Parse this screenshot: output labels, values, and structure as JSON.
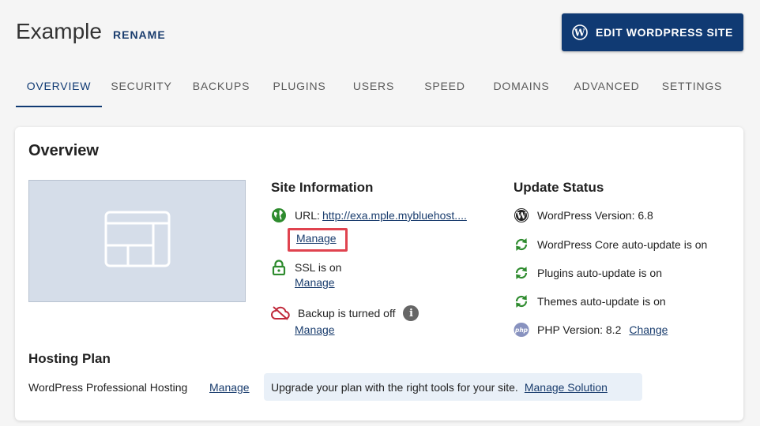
{
  "header": {
    "site_name": "Example",
    "rename_label": "RENAME",
    "edit_button_label": "EDIT WORDPRESS SITE"
  },
  "tabs": [
    {
      "label": "OVERVIEW",
      "active": true
    },
    {
      "label": "SECURITY"
    },
    {
      "label": "BACKUPS"
    },
    {
      "label": "PLUGINS"
    },
    {
      "label": "USERS"
    },
    {
      "label": "SPEED"
    },
    {
      "label": "DOMAINS"
    },
    {
      "label": "ADVANCED"
    },
    {
      "label": "SETTINGS"
    }
  ],
  "overview": {
    "title": "Overview",
    "site_info": {
      "title": "Site Information",
      "url_label": "URL:",
      "url_value": "http://exa.mple.mybluehost....",
      "url_manage": "Manage",
      "ssl_text": "SSL is on",
      "ssl_manage": "Manage",
      "backup_text": "Backup is turned off",
      "backup_info": "i",
      "backup_manage": "Manage"
    },
    "update_status": {
      "title": "Update Status",
      "wp_version": "WordPress Version: 6.8",
      "core_autoupdate": "WordPress Core auto-update is on",
      "plugins_autoupdate": "Plugins auto-update is on",
      "themes_autoupdate": "Themes auto-update is on",
      "php_version": "PHP Version: 8.2",
      "php_change": "Change",
      "php_icon_text": "php"
    },
    "hosting": {
      "title": "Hosting Plan",
      "plan_name": "WordPress Professional Hosting",
      "plan_manage": "Manage",
      "upgrade_text": "Upgrade your plan with the right tools for your site.",
      "upgrade_link": "Manage Solution"
    }
  },
  "colors": {
    "primary": "#103a73",
    "link": "#1a3d6e",
    "success": "#2e8b2e",
    "danger": "#c0283a",
    "highlight": "#e0434f",
    "thumb_bg": "#d5dde9"
  },
  "icons": {
    "wordpress": "wordpress-icon",
    "globe": "globe-icon",
    "lock": "lock-icon",
    "cloud_off": "cloud-off-icon",
    "info": "info-icon",
    "refresh": "refresh-icon",
    "php": "php-icon",
    "layout": "layout-placeholder-icon"
  }
}
